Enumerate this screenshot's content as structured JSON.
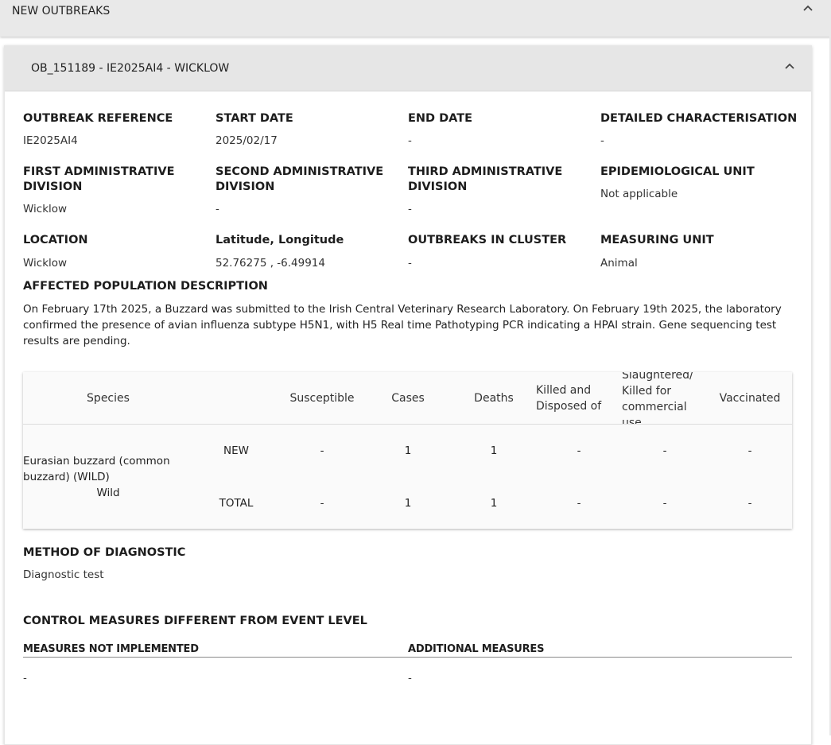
{
  "section": {
    "title": "NEW OUTBREAKS",
    "icon": "chevron-up-icon"
  },
  "outbreak": {
    "title": "OB_151189 - IE2025AI4 - WICKLOW",
    "icon": "chevron-up-icon",
    "fields": {
      "reference": {
        "label": "OUTBREAK REFERENCE",
        "value": "IE2025AI4"
      },
      "start_date": {
        "label": "START DATE",
        "value": "2025/02/17"
      },
      "end_date": {
        "label": "END DATE",
        "value": "-"
      },
      "characterisation": {
        "label": "DETAILED CHARACTERISATION",
        "value": "-"
      },
      "first_admin": {
        "label_line1": "FIRST ADMINISTRATIVE",
        "label_line2": "DIVISION",
        "value": "Wicklow"
      },
      "second_admin": {
        "label_line1": "SECOND ADMINISTRATIVE",
        "label_line2": "DIVISION",
        "value": "-"
      },
      "third_admin": {
        "label_line1": "THIRD ADMINISTRATIVE",
        "label_line2": "DIVISION",
        "value": "-"
      },
      "epi_unit": {
        "label": "EPIDEMIOLOGICAL UNIT",
        "value": "Not applicable"
      },
      "location": {
        "label": "LOCATION",
        "value": "Wicklow"
      },
      "latlng": {
        "label": "Latitude, Longitude",
        "value": "52.76275 , -6.49914"
      },
      "cluster": {
        "label": "OUTBREAKS IN CLUSTER",
        "value": "-"
      },
      "measuring_unit": {
        "label": "MEASURING UNIT",
        "value": "Animal"
      }
    },
    "affected": {
      "label": "AFFECTED POPULATION DESCRIPTION",
      "text": "On February 17th 2025, a Buzzard was submitted to the Irish Central Veterinary Research Laboratory. On February 19th 2025, the laboratory confirmed the presence of avian influenza subtype H5N1, with H5 Real time Pathotyping PCR indicating a HPAI strain. Gene sequencing test results are pending."
    },
    "table": {
      "headers": {
        "species": "Species",
        "susceptible": "Susceptible",
        "cases": "Cases",
        "deaths": "Deaths",
        "killed_line1": "Killed and",
        "killed_line2": "Disposed of",
        "slaughtered_line1": "Slaughtered/",
        "slaughtered_line2": "Killed for",
        "slaughtered_line3": "commercial",
        "slaughtered_line4": "use",
        "vaccinated": "Vaccinated"
      },
      "species_name_line1": "Eurasian buzzard (common",
      "species_name_line2": "buzzard) (WILD)",
      "species_type": "Wild",
      "rows": [
        {
          "label": "NEW",
          "susceptible": "-",
          "cases": "1",
          "deaths": "1",
          "killed": "-",
          "slaughtered": "-",
          "vaccinated": "-"
        },
        {
          "label": "TOTAL",
          "susceptible": "-",
          "cases": "1",
          "deaths": "1",
          "killed": "-",
          "slaughtered": "-",
          "vaccinated": "-"
        }
      ]
    },
    "diagnostic": {
      "label": "METHOD OF DIAGNOSTIC",
      "value": "Diagnostic test"
    },
    "control": {
      "title": "CONTROL MEASURES DIFFERENT FROM EVENT LEVEL",
      "not_implemented_label": "MEASURES NOT IMPLEMENTED",
      "not_implemented_value": "-",
      "additional_label": "ADDITIONAL MEASURES",
      "additional_value": "-"
    }
  }
}
